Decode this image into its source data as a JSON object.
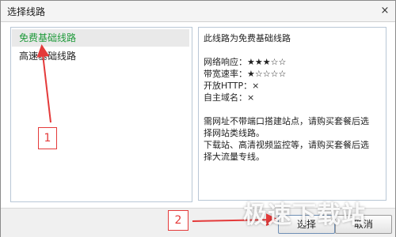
{
  "window": {
    "title": "选择线路",
    "close_icon": "×"
  },
  "routes": [
    {
      "label": "免费基础线路",
      "selected": true
    },
    {
      "label": "高速基础线路",
      "selected": false
    }
  ],
  "description": {
    "heading": "此线路为免费基础线路",
    "network_response": "网络响应：★★★☆☆",
    "bandwidth_rate": "带宽速率：★☆☆☆☆",
    "http_open": "开放HTTP：×",
    "custom_domain": "自主域名：×",
    "note_1a": "需网址不带端口搭建站点，请购买套餐后选",
    "note_1b": "择网站类线路。",
    "note_2a": "下载站、高清视频监控等，请购买套餐后选",
    "note_2b": "择大流量专线。"
  },
  "buttons": {
    "select": "选择",
    "cancel": "取消"
  },
  "annotations": {
    "step1": "1",
    "step2": "2"
  },
  "watermark": "极速下载站",
  "colors": {
    "selected_text": "#1f9a3a",
    "annotation": "#e43a3a",
    "panel_border": "#b9c7d6"
  }
}
